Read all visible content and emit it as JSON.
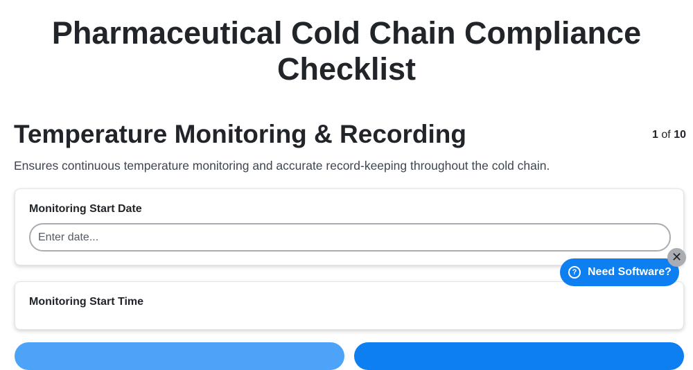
{
  "page": {
    "title": "Pharmaceutical Cold Chain Compliance Checklist"
  },
  "section": {
    "title": "Temperature Monitoring & Recording",
    "description": "Ensures continuous temperature monitoring and accurate record-keeping throughout the cold chain.",
    "step_current": "1",
    "step_of": "of",
    "step_total": "10"
  },
  "fields": [
    {
      "label": "Monitoring Start Date",
      "value": "",
      "placeholder": "Enter date..."
    },
    {
      "label": "Monitoring Start Time"
    }
  ],
  "promo": {
    "label": "Need Software?",
    "icon": "help-circle-icon",
    "close_icon": "close-icon",
    "close_glyph": "✕",
    "help_glyph": "?"
  },
  "colors": {
    "primary": "#0d7ff0",
    "primary_light": "#4da3f7",
    "close_bg": "#a9adb2"
  }
}
